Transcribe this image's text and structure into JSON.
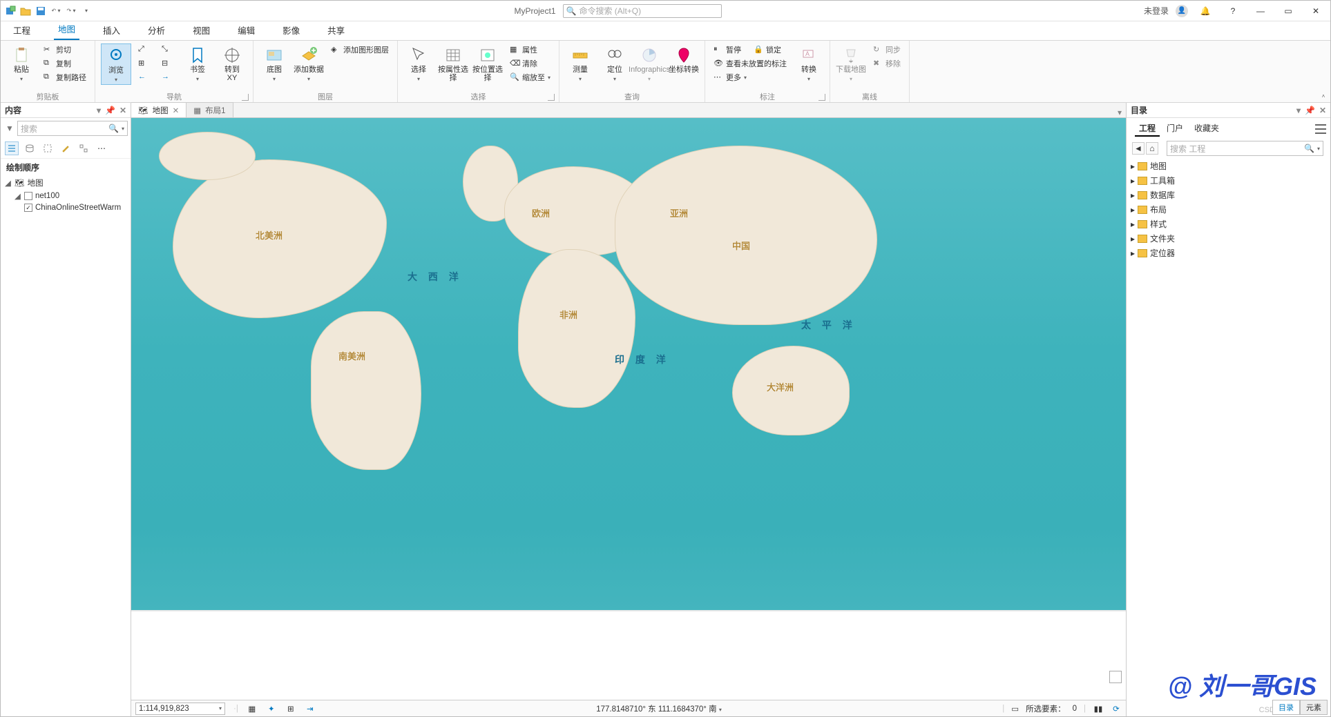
{
  "title": {
    "project": "MyProject1",
    "search_placeholder": "命令搜索 (Alt+Q)"
  },
  "titlebar_right": {
    "login": "未登录"
  },
  "ribbon_tabs": [
    "工程",
    "地图",
    "插入",
    "分析",
    "视图",
    "编辑",
    "影像",
    "共享"
  ],
  "ribbon": {
    "clipboard": {
      "paste": "粘贴",
      "cut": "剪切",
      "copy": "复制",
      "copypath": "复制路径",
      "label": "剪贴板"
    },
    "nav": {
      "explore": "浏览",
      "bookmarks": "书签",
      "goxy": "转到\nXY",
      "label": "导航"
    },
    "layer": {
      "basemap": "底图",
      "adddata": "添加数据",
      "addgfx": "添加图形图层",
      "label": "图层"
    },
    "select": {
      "select": "选择",
      "byattr": "按属性选择",
      "byloc": "按位置选择",
      "attrs": "属性",
      "clear": "清除",
      "zoomto": "缩放至",
      "label": "选择"
    },
    "query": {
      "measure": "测量",
      "locate": "定位",
      "info": "Infographics",
      "coord": "坐标转换",
      "label": "查询"
    },
    "annot": {
      "pause": "暂停",
      "lock": "锁定",
      "viewunplaced": "查看未放置的标注",
      "more": "更多",
      "convert": "转换",
      "label": "标注"
    },
    "offline": {
      "download": "下载地图",
      "sync": "同步",
      "remove": "移除",
      "label": "离线"
    }
  },
  "contents": {
    "title": "内容",
    "search_placeholder": "搜索",
    "section": "绘制顺序",
    "map_node": "地图",
    "layers": [
      {
        "name": "net100",
        "checked": false
      },
      {
        "name": "ChinaOnlineStreetWarm",
        "checked": true
      }
    ]
  },
  "views": {
    "tabs": [
      {
        "label": "地图"
      },
      {
        "label": "布局1"
      }
    ]
  },
  "map_labels": {
    "na": "北美洲",
    "sa": "南美洲",
    "eu": "欧洲",
    "af": "非洲",
    "as": "亚洲",
    "china": "中国",
    "oceania": "大洋洲",
    "atlantic": "大 西 洋",
    "indian": "印 度 洋",
    "pacific": "太 平 洋"
  },
  "watermark": "@ 刘一哥GIS",
  "csdn": "CSDN @刘一哥GIS",
  "catalog": {
    "title": "目录",
    "tabs": [
      "工程",
      "门户",
      "收藏夹"
    ],
    "search_placeholder": "搜索 工程",
    "items": [
      "地图",
      "工具箱",
      "数据库",
      "布局",
      "样式",
      "文件夹",
      "定位器"
    ]
  },
  "statusbar": {
    "scale": "1:114,919,823",
    "coords": "177.8148710° 东 111.1684370° 南",
    "selected_label": "所选要素：",
    "selected_count": "0"
  },
  "bottom_tabs": [
    "目录",
    "元素"
  ]
}
